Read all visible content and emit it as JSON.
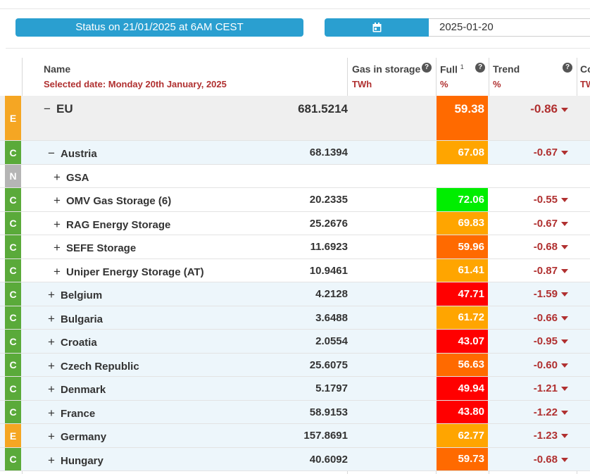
{
  "status_button": {
    "label": "Status on 21/01/2025 at 6AM CEST"
  },
  "date_picker": {
    "value": "2025-01-20",
    "icon": "calendar-icon"
  },
  "columns": {
    "name": {
      "title": "Name",
      "subtitle": "Selected date: Monday 20th January, 2025"
    },
    "gas": {
      "title": "Gas in storage",
      "unit": "TWh"
    },
    "full": {
      "title": "Full",
      "sup": "1",
      "unit": "%"
    },
    "trend": {
      "title": "Trend",
      "unit": "%"
    },
    "next": {
      "title": "Co",
      "unit": "TW"
    }
  },
  "help_icon": "?",
  "toggle_symbols": {
    "expanded": "−",
    "collapsed": "+"
  },
  "badge_colors": {
    "E": "#f5a623",
    "C": "#5aaa3a",
    "N": "#b5b5b5"
  },
  "rows": [
    {
      "badge": "E",
      "name": "EU",
      "level": 0,
      "expanded": true,
      "gas": "681.5214",
      "full": "59.38",
      "full_color": "#ff6a00",
      "trend": "-0.86"
    },
    {
      "badge": "C",
      "name": "Austria",
      "level": 1,
      "expanded": true,
      "gas": "68.1394",
      "full": "67.08",
      "full_color": "#ffa500",
      "trend": "-0.67"
    },
    {
      "badge": "N",
      "name": "GSA",
      "level": 2,
      "expanded": false,
      "gas": "",
      "full": "",
      "full_color": "",
      "trend": ""
    },
    {
      "badge": "C",
      "name": "OMV Gas Storage (6)",
      "level": 2,
      "expanded": false,
      "gas": "20.2335",
      "full": "72.06",
      "full_color": "#00ee00",
      "trend": "-0.55"
    },
    {
      "badge": "C",
      "name": "RAG Energy Storage",
      "level": 2,
      "expanded": false,
      "gas": "25.2676",
      "full": "69.83",
      "full_color": "#ffa500",
      "trend": "-0.67"
    },
    {
      "badge": "C",
      "name": "SEFE Storage",
      "level": 2,
      "expanded": false,
      "gas": "11.6923",
      "full": "59.96",
      "full_color": "#ff6a00",
      "trend": "-0.68"
    },
    {
      "badge": "C",
      "name": "Uniper Energy Storage (AT)",
      "level": 2,
      "expanded": false,
      "gas": "10.9461",
      "full": "61.41",
      "full_color": "#ffa500",
      "trend": "-0.87"
    },
    {
      "badge": "C",
      "name": "Belgium",
      "level": 1,
      "expanded": false,
      "gas": "4.2128",
      "full": "47.71",
      "full_color": "#ff0000",
      "trend": "-1.59"
    },
    {
      "badge": "C",
      "name": "Bulgaria",
      "level": 1,
      "expanded": false,
      "gas": "3.6488",
      "full": "61.72",
      "full_color": "#ffa500",
      "trend": "-0.66"
    },
    {
      "badge": "C",
      "name": "Croatia",
      "level": 1,
      "expanded": false,
      "gas": "2.0554",
      "full": "43.07",
      "full_color": "#ff0000",
      "trend": "-0.95"
    },
    {
      "badge": "C",
      "name": "Czech Republic",
      "level": 1,
      "expanded": false,
      "gas": "25.6075",
      "full": "56.63",
      "full_color": "#ff6a00",
      "trend": "-0.60"
    },
    {
      "badge": "C",
      "name": "Denmark",
      "level": 1,
      "expanded": false,
      "gas": "5.1797",
      "full": "49.94",
      "full_color": "#ff0000",
      "trend": "-1.21"
    },
    {
      "badge": "C",
      "name": "France",
      "level": 1,
      "expanded": false,
      "gas": "58.9153",
      "full": "43.80",
      "full_color": "#ff0000",
      "trend": "-1.22"
    },
    {
      "badge": "E",
      "name": "Germany",
      "level": 1,
      "expanded": false,
      "gas": "157.8691",
      "full": "62.77",
      "full_color": "#ffa500",
      "trend": "-1.23"
    },
    {
      "badge": "C",
      "name": "Hungary",
      "level": 1,
      "expanded": false,
      "gas": "40.6092",
      "full": "59.73",
      "full_color": "#ff6a00",
      "trend": "-0.68"
    }
  ]
}
